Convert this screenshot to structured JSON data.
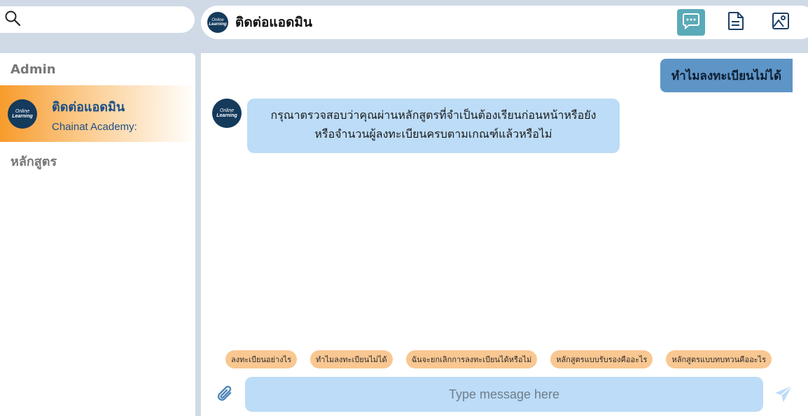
{
  "search": {
    "placeholder": "",
    "icon": "search-icon"
  },
  "header": {
    "logo_line1": "Online",
    "logo_line2": "Learning",
    "title": "ติดต่อแอดมิน",
    "tools": [
      "chat-icon",
      "document-icon",
      "image-icon"
    ],
    "active_tool_color": "#5baab8"
  },
  "sidebar": {
    "admin_label": "Admin",
    "contact": {
      "name": "ติดต่อแอดมิน",
      "subtitle": "Chainat Academy:"
    },
    "courses_label": "หลักสูตร"
  },
  "chat": {
    "outgoing": "ทำไมลงทะเบียนไม่ได้",
    "incoming_line1": "กรุณาตรวจสอบว่าคุณผ่านหลักสูตรที่จำเป็นต้องเรียนก่อนหน้าหรือยัง",
    "incoming_line2": "หรือจำนวนผู้ลงทะเบียนครบตามเกณฑ์แล้วหรือไม่",
    "quick_replies": [
      "ลงทะเบียนอย่างไร",
      "ทำไมลงทะเบียนไม่ได้",
      "ฉันจะยกเลิกการลงทะเบียนได้หรือไม่",
      "หลักสูตรแบบรับรองคืออะไร",
      "หลักสูตรแบบทบทวนคืออะไร"
    ],
    "input_placeholder": "Type message here"
  },
  "colors": {
    "outgoing_bubble": "#5e95c7",
    "incoming_bubble": "#bcdcf7",
    "chip": "#f9c791",
    "accent_orange": "#f79b2c"
  }
}
